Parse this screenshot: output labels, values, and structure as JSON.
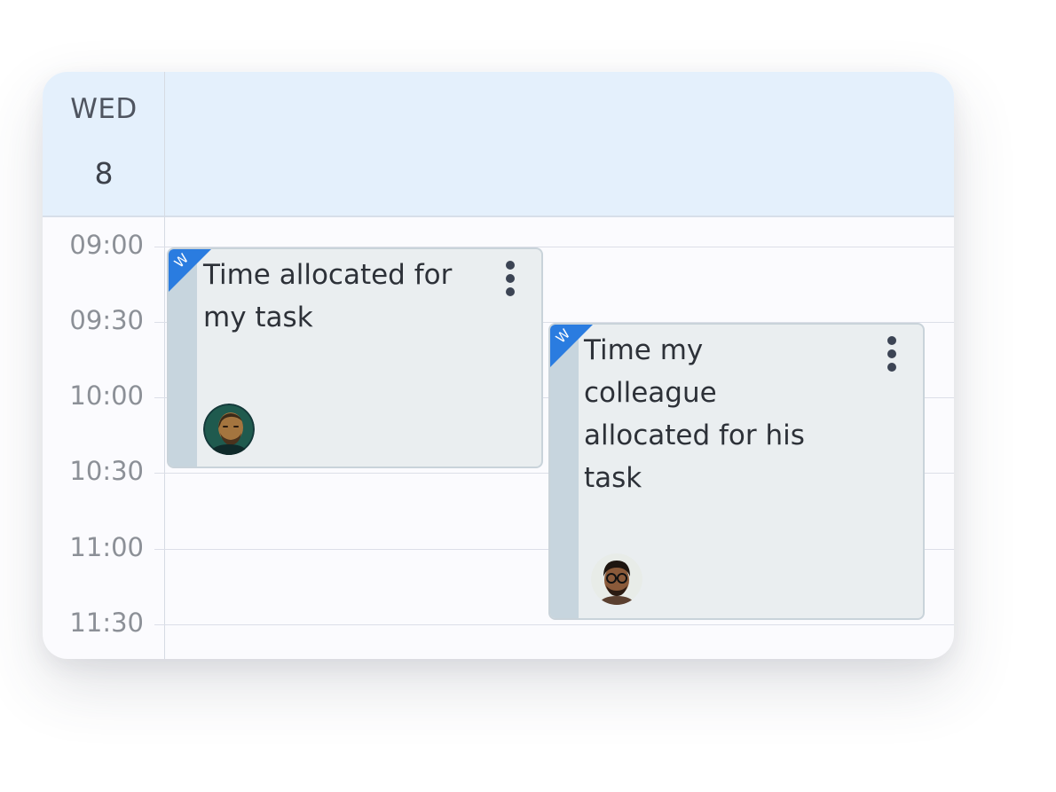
{
  "header": {
    "day_name": "WED",
    "day_number": "8"
  },
  "time_slots": [
    "09:00",
    "09:30",
    "10:00",
    "10:30",
    "11:00",
    "11:30"
  ],
  "events": [
    {
      "title_lines": [
        "Time allocated for",
        "my task"
      ],
      "corner_letter": "W",
      "avatar": "avatar-man-beard"
    },
    {
      "title_lines": [
        "Time my",
        "colleague",
        "allocated for his",
        "task"
      ],
      "corner_letter": "W",
      "avatar": "avatar-man-glasses"
    }
  ],
  "colors": {
    "header_bg": "#e4f0fc",
    "event_bg": "#eaeef0",
    "event_strip": "#c7d5de",
    "corner_accent": "#2a7ce0"
  },
  "icons": {
    "event_menu": "kebab-menu-icon"
  }
}
